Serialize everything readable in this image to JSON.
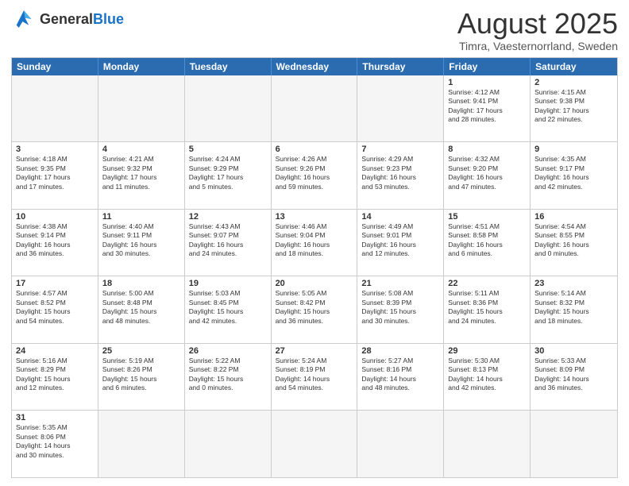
{
  "header": {
    "logo_general": "General",
    "logo_blue": "Blue",
    "month": "August 2025",
    "location": "Timra, Vaesternorrland, Sweden"
  },
  "days_of_week": [
    "Sunday",
    "Monday",
    "Tuesday",
    "Wednesday",
    "Thursday",
    "Friday",
    "Saturday"
  ],
  "weeks": [
    [
      {
        "day": "",
        "info": ""
      },
      {
        "day": "",
        "info": ""
      },
      {
        "day": "",
        "info": ""
      },
      {
        "day": "",
        "info": ""
      },
      {
        "day": "",
        "info": ""
      },
      {
        "day": "1",
        "info": "Sunrise: 4:12 AM\nSunset: 9:41 PM\nDaylight: 17 hours\nand 28 minutes."
      },
      {
        "day": "2",
        "info": "Sunrise: 4:15 AM\nSunset: 9:38 PM\nDaylight: 17 hours\nand 22 minutes."
      }
    ],
    [
      {
        "day": "3",
        "info": "Sunrise: 4:18 AM\nSunset: 9:35 PM\nDaylight: 17 hours\nand 17 minutes."
      },
      {
        "day": "4",
        "info": "Sunrise: 4:21 AM\nSunset: 9:32 PM\nDaylight: 17 hours\nand 11 minutes."
      },
      {
        "day": "5",
        "info": "Sunrise: 4:24 AM\nSunset: 9:29 PM\nDaylight: 17 hours\nand 5 minutes."
      },
      {
        "day": "6",
        "info": "Sunrise: 4:26 AM\nSunset: 9:26 PM\nDaylight: 16 hours\nand 59 minutes."
      },
      {
        "day": "7",
        "info": "Sunrise: 4:29 AM\nSunset: 9:23 PM\nDaylight: 16 hours\nand 53 minutes."
      },
      {
        "day": "8",
        "info": "Sunrise: 4:32 AM\nSunset: 9:20 PM\nDaylight: 16 hours\nand 47 minutes."
      },
      {
        "day": "9",
        "info": "Sunrise: 4:35 AM\nSunset: 9:17 PM\nDaylight: 16 hours\nand 42 minutes."
      }
    ],
    [
      {
        "day": "10",
        "info": "Sunrise: 4:38 AM\nSunset: 9:14 PM\nDaylight: 16 hours\nand 36 minutes."
      },
      {
        "day": "11",
        "info": "Sunrise: 4:40 AM\nSunset: 9:11 PM\nDaylight: 16 hours\nand 30 minutes."
      },
      {
        "day": "12",
        "info": "Sunrise: 4:43 AM\nSunset: 9:07 PM\nDaylight: 16 hours\nand 24 minutes."
      },
      {
        "day": "13",
        "info": "Sunrise: 4:46 AM\nSunset: 9:04 PM\nDaylight: 16 hours\nand 18 minutes."
      },
      {
        "day": "14",
        "info": "Sunrise: 4:49 AM\nSunset: 9:01 PM\nDaylight: 16 hours\nand 12 minutes."
      },
      {
        "day": "15",
        "info": "Sunrise: 4:51 AM\nSunset: 8:58 PM\nDaylight: 16 hours\nand 6 minutes."
      },
      {
        "day": "16",
        "info": "Sunrise: 4:54 AM\nSunset: 8:55 PM\nDaylight: 16 hours\nand 0 minutes."
      }
    ],
    [
      {
        "day": "17",
        "info": "Sunrise: 4:57 AM\nSunset: 8:52 PM\nDaylight: 15 hours\nand 54 minutes."
      },
      {
        "day": "18",
        "info": "Sunrise: 5:00 AM\nSunset: 8:48 PM\nDaylight: 15 hours\nand 48 minutes."
      },
      {
        "day": "19",
        "info": "Sunrise: 5:03 AM\nSunset: 8:45 PM\nDaylight: 15 hours\nand 42 minutes."
      },
      {
        "day": "20",
        "info": "Sunrise: 5:05 AM\nSunset: 8:42 PM\nDaylight: 15 hours\nand 36 minutes."
      },
      {
        "day": "21",
        "info": "Sunrise: 5:08 AM\nSunset: 8:39 PM\nDaylight: 15 hours\nand 30 minutes."
      },
      {
        "day": "22",
        "info": "Sunrise: 5:11 AM\nSunset: 8:36 PM\nDaylight: 15 hours\nand 24 minutes."
      },
      {
        "day": "23",
        "info": "Sunrise: 5:14 AM\nSunset: 8:32 PM\nDaylight: 15 hours\nand 18 minutes."
      }
    ],
    [
      {
        "day": "24",
        "info": "Sunrise: 5:16 AM\nSunset: 8:29 PM\nDaylight: 15 hours\nand 12 minutes."
      },
      {
        "day": "25",
        "info": "Sunrise: 5:19 AM\nSunset: 8:26 PM\nDaylight: 15 hours\nand 6 minutes."
      },
      {
        "day": "26",
        "info": "Sunrise: 5:22 AM\nSunset: 8:22 PM\nDaylight: 15 hours\nand 0 minutes."
      },
      {
        "day": "27",
        "info": "Sunrise: 5:24 AM\nSunset: 8:19 PM\nDaylight: 14 hours\nand 54 minutes."
      },
      {
        "day": "28",
        "info": "Sunrise: 5:27 AM\nSunset: 8:16 PM\nDaylight: 14 hours\nand 48 minutes."
      },
      {
        "day": "29",
        "info": "Sunrise: 5:30 AM\nSunset: 8:13 PM\nDaylight: 14 hours\nand 42 minutes."
      },
      {
        "day": "30",
        "info": "Sunrise: 5:33 AM\nSunset: 8:09 PM\nDaylight: 14 hours\nand 36 minutes."
      }
    ],
    [
      {
        "day": "31",
        "info": "Sunrise: 5:35 AM\nSunset: 8:06 PM\nDaylight: 14 hours\nand 30 minutes."
      },
      {
        "day": "",
        "info": ""
      },
      {
        "day": "",
        "info": ""
      },
      {
        "day": "",
        "info": ""
      },
      {
        "day": "",
        "info": ""
      },
      {
        "day": "",
        "info": ""
      },
      {
        "day": "",
        "info": ""
      }
    ]
  ]
}
